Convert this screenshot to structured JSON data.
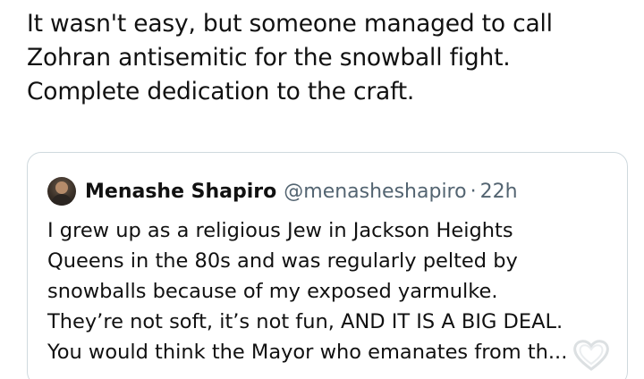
{
  "post": {
    "lines": [
      "It wasn't easy, but someone managed to call",
      "Zohran antisemitic for the snowball fight.",
      "Complete dedication to the craft."
    ]
  },
  "quote": {
    "author_name": "Menashe Shapiro",
    "author_handle": "@menasheshapiro",
    "separator": "·",
    "timestamp": "22h",
    "lines": [
      "I grew up as a religious Jew in Jackson Heights",
      "Queens in the 80s and was regularly pelted by",
      "snowballs because of my exposed yarmulke.",
      "They’re not soft, it’s not fun, AND IT IS A BIG DEAL.",
      "You would think the Mayor who emanates from th..."
    ]
  },
  "icons": {
    "watermark": "heart-icon"
  }
}
